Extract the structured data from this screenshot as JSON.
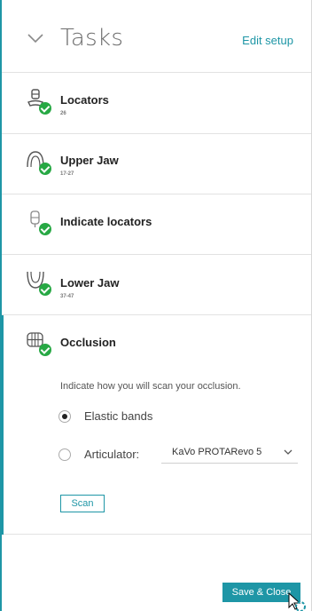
{
  "header": {
    "title": "Tasks",
    "edit_label": "Edit setup"
  },
  "tasks": [
    {
      "label": "Locators",
      "sub": "26",
      "icon": "locator-icon",
      "done": true
    },
    {
      "label": "Upper Jaw",
      "sub": "17-27",
      "icon": "upper-jaw-icon",
      "done": true
    },
    {
      "label": "Indicate locators",
      "sub": "",
      "icon": "indicate-locator-icon",
      "done": true
    },
    {
      "label": "Lower Jaw",
      "sub": "37-47",
      "icon": "lower-jaw-icon",
      "done": true
    },
    {
      "label": "Occlusion",
      "sub": "",
      "icon": "occlusion-icon",
      "done": true
    }
  ],
  "occlusion": {
    "instruction": "Indicate how you will scan your occlusion.",
    "options": [
      {
        "label": "Elastic bands",
        "selected": true
      },
      {
        "label": "Articulator:",
        "selected": false
      }
    ],
    "articulator_value": "KaVo PROTARevo 5",
    "scan_label": "Scan"
  },
  "footer": {
    "save_label": "Save & Close"
  },
  "colors": {
    "accent": "#1e96a6",
    "success": "#27a844"
  }
}
